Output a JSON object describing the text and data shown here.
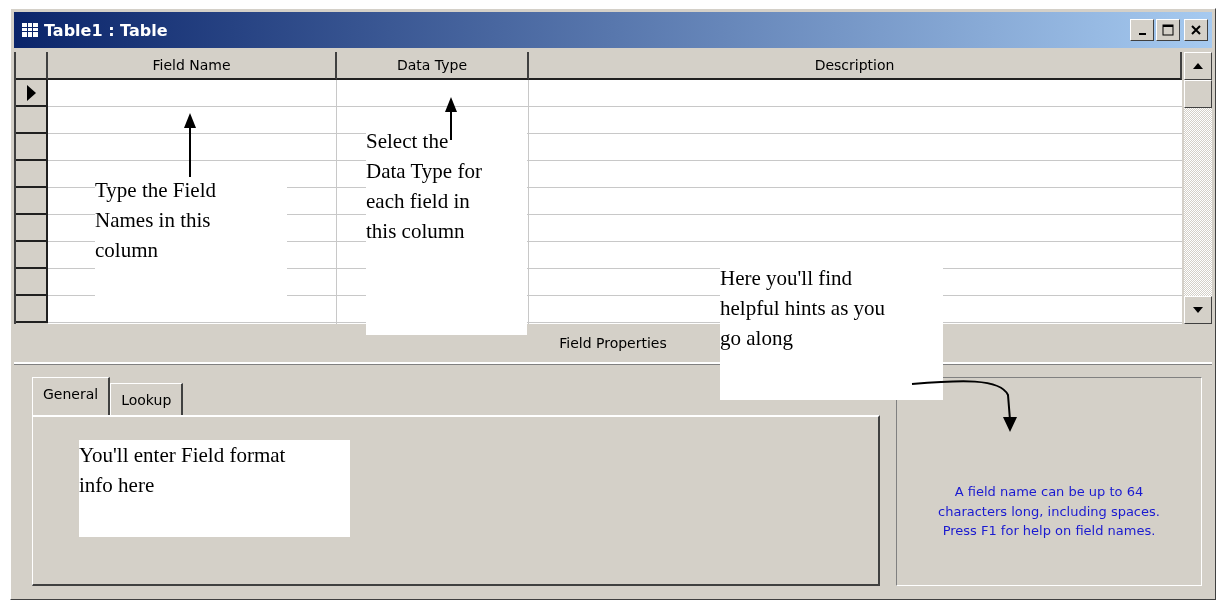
{
  "window": {
    "title": "Table1 : Table"
  },
  "table": {
    "columns": [
      {
        "label": "Field Name"
      },
      {
        "label": "Data Type"
      },
      {
        "label": "Description"
      }
    ],
    "rows": [
      {
        "current": true
      },
      {
        "current": false
      },
      {
        "current": false
      },
      {
        "current": false
      },
      {
        "current": false
      },
      {
        "current": false
      },
      {
        "current": false
      },
      {
        "current": false
      },
      {
        "current": false
      }
    ]
  },
  "field_properties": {
    "label": "Field Properties",
    "tabs": [
      {
        "label": "General",
        "selected": true
      },
      {
        "label": "Lookup",
        "selected": false
      }
    ],
    "hint": "A field name can be up to 64 characters long, including spaces.  Press F1 for help on field names."
  },
  "annotations": [
    {
      "text": "Type the Field Names in this column"
    },
    {
      "text": "Select the Data Type for each field in this column"
    },
    {
      "text": "Here you'll find helpful hints as you go along"
    },
    {
      "text": "You'll enter Field format info here"
    }
  ]
}
